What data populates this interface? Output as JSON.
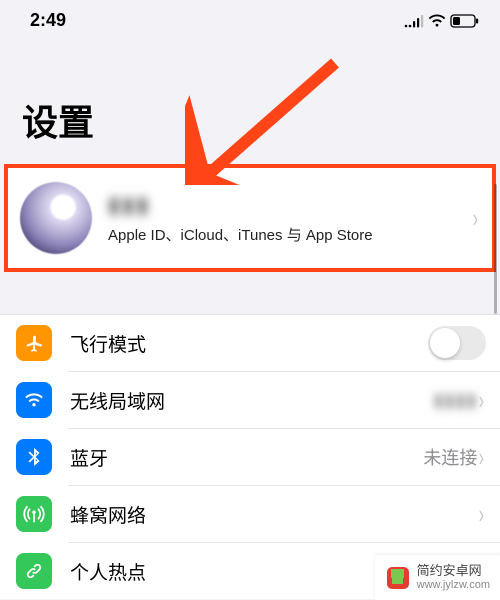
{
  "status": {
    "time": "2:49"
  },
  "title": "设置",
  "profile": {
    "name": "▮▮▮",
    "subtitle": "Apple ID、iCloud、iTunes 与 App Store"
  },
  "rows": {
    "airplane": {
      "label": "飞行模式",
      "color": "#ff9500"
    },
    "wifi": {
      "label": "无线局域网",
      "value": "▮▮▮▮",
      "color": "#007aff"
    },
    "bt": {
      "label": "蓝牙",
      "value": "未连接",
      "color": "#007aff"
    },
    "cell": {
      "label": "蜂窝网络",
      "color": "#34c759"
    },
    "hotspot": {
      "label": "个人热点",
      "value": "▮▮",
      "color": "#34c759"
    }
  },
  "watermark": {
    "line1": "简约安卓网",
    "line2": "www.jylzw.com"
  }
}
